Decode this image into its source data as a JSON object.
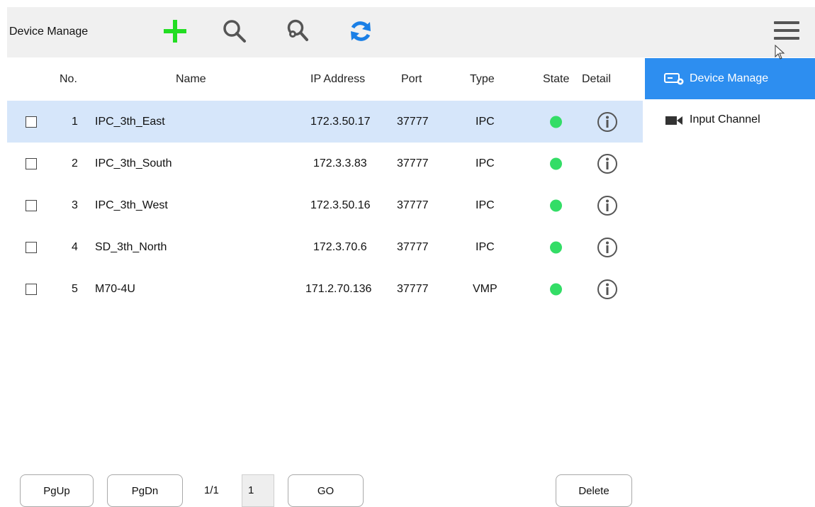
{
  "toolbar": {
    "title": "Device Manage",
    "icons": [
      "add-icon",
      "search-icon",
      "advanced-search-icon",
      "refresh-icon",
      "menu-icon"
    ],
    "colors": {
      "add": "#22dd22",
      "search": "#555555",
      "refresh": "#1a7fe6"
    }
  },
  "table": {
    "headers": {
      "no": "No.",
      "name": "Name",
      "ip": "IP Address",
      "port": "Port",
      "type": "Type",
      "state": "State",
      "detail": "Detail"
    },
    "rows": [
      {
        "no": "1",
        "name": "IPC_3th_East",
        "ip": "172.3.50.17",
        "port": "37777",
        "type": "IPC",
        "selected": true
      },
      {
        "no": "2",
        "name": "IPC_3th_South",
        "ip": "172.3.3.83",
        "port": "37777",
        "type": "IPC"
      },
      {
        "no": "3",
        "name": "IPC_3th_West",
        "ip": "172.3.50.16",
        "port": "37777",
        "type": "IPC"
      },
      {
        "no": "4",
        "name": "SD_3th_North",
        "ip": "172.3.70.6",
        "port": "37777",
        "type": "IPC"
      },
      {
        "no": "5",
        "name": "M70-4U",
        "ip": "171.2.70.136",
        "port": "37777",
        "type": "VMP"
      }
    ],
    "state_color": "#33dd66",
    "selected_row_color": "#d6e6fa"
  },
  "sidebar": {
    "items": [
      {
        "label": "Device Manage",
        "icon": "device-manage-icon",
        "active": true
      },
      {
        "label": "Input Channel",
        "icon": "camera-icon",
        "active": false
      }
    ],
    "active_color": "#2d8ef0"
  },
  "footer": {
    "pgup": "PgUp",
    "pgdn": "PgDn",
    "page_info": "1/1",
    "page_input": "1",
    "go": "GO",
    "delete": "Delete"
  }
}
